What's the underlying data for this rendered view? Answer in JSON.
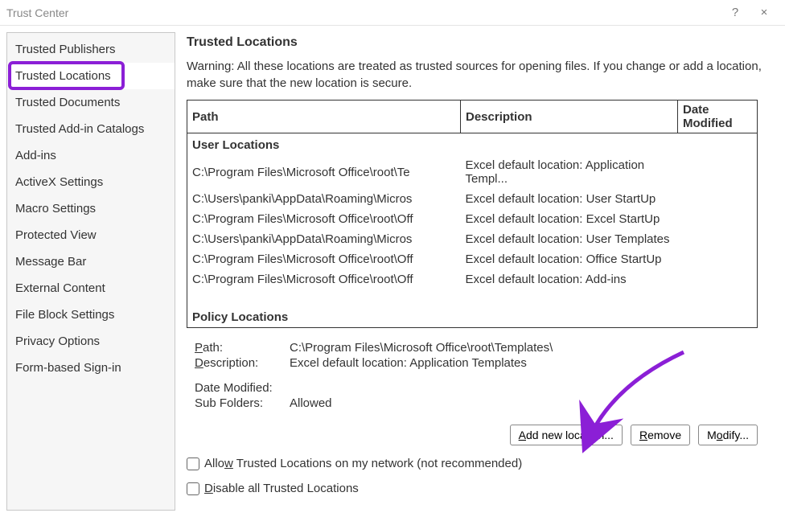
{
  "window": {
    "title": "Trust Center",
    "help": "?",
    "close": "×"
  },
  "sidebar": {
    "items": [
      {
        "label": "Trusted Publishers",
        "selected": false
      },
      {
        "label": "Trusted Locations",
        "selected": true
      },
      {
        "label": "Trusted Documents",
        "selected": false
      },
      {
        "label": "Trusted Add-in Catalogs",
        "selected": false
      },
      {
        "label": "Add-ins",
        "selected": false
      },
      {
        "label": "ActiveX Settings",
        "selected": false
      },
      {
        "label": "Macro Settings",
        "selected": false
      },
      {
        "label": "Protected View",
        "selected": false
      },
      {
        "label": "Message Bar",
        "selected": false
      },
      {
        "label": "External Content",
        "selected": false
      },
      {
        "label": "File Block Settings",
        "selected": false
      },
      {
        "label": "Privacy Options",
        "selected": false
      },
      {
        "label": "Form-based Sign-in",
        "selected": false
      }
    ]
  },
  "main": {
    "heading": "Trusted Locations",
    "warning": "Warning: All these locations are treated as trusted sources for opening files.  If you change or add a location, make sure that the new location is secure.",
    "columns": {
      "path": "Path",
      "desc": "Description",
      "date": "Date Modified"
    },
    "groups": {
      "user": "User Locations",
      "policy": "Policy Locations"
    },
    "rows": [
      {
        "path": "C:\\Program Files\\Microsoft Office\\root\\Te",
        "desc": "Excel default location: Application Templ...",
        "selected": true
      },
      {
        "path": "C:\\Users\\panki\\AppData\\Roaming\\Micros",
        "desc": "Excel default location: User StartUp"
      },
      {
        "path": "C:\\Program Files\\Microsoft Office\\root\\Off",
        "desc": "Excel default location: Excel StartUp"
      },
      {
        "path": "C:\\Users\\panki\\AppData\\Roaming\\Micros",
        "desc": "Excel default location: User Templates"
      },
      {
        "path": "C:\\Program Files\\Microsoft Office\\root\\Off",
        "desc": "Excel default location: Office StartUp"
      },
      {
        "path": "C:\\Program Files\\Microsoft Office\\root\\Off",
        "desc": "Excel default location: Add-ins"
      }
    ],
    "details": {
      "path_label": "Path:",
      "path_value": "C:\\Program Files\\Microsoft Office\\root\\Templates\\",
      "desc_label": "Description:",
      "desc_value": "Excel default location: Application Templates",
      "date_label": "Date Modified:",
      "date_value": "",
      "sub_label": "Sub Folders:",
      "sub_value": "Allowed"
    },
    "buttons": {
      "add": "Add new location...",
      "remove": "Remove",
      "modify": "Modify..."
    },
    "checks": {
      "allow_network": "Allow Trusted Locations on my network (not recommended)",
      "disable_all": "Disable all Trusted Locations"
    }
  }
}
